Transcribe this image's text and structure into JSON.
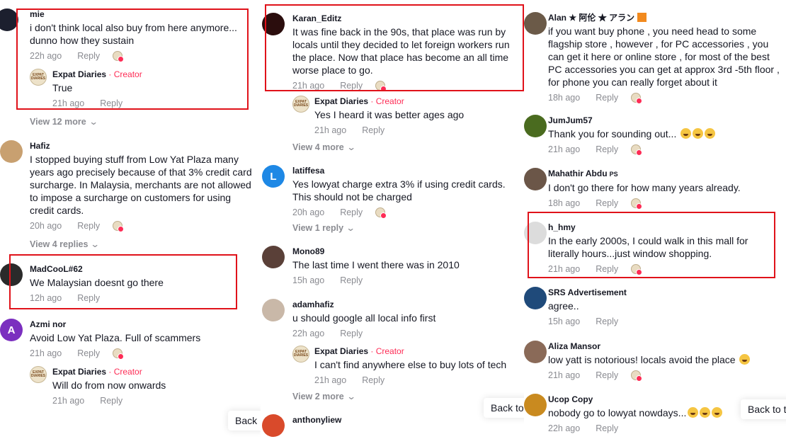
{
  "col1": {
    "c1": {
      "user": "mie",
      "text": "i don't think local also buy from here anymore... dunno how they sustain",
      "time": "22h ago",
      "reply": "Reply"
    },
    "c1r": {
      "user": "Expat Diaries",
      "tag": " · Creator",
      "text": "True",
      "time": "21h ago",
      "reply": "Reply"
    },
    "c1more": "View 12 more",
    "c2": {
      "user": "Hafiz",
      "text": "I stopped buying stuff from Low Yat Plaza many years ago precisely because of that 3% credit card surcharge. In Malaysia, merchants are not allowed to impose a surcharge on customers for using credit cards.",
      "time": "20h ago",
      "reply": "Reply"
    },
    "c2more": "View 4 replies",
    "c3": {
      "user": "MadCooL#62",
      "text": "We Malaysian doesnt go there",
      "time": "12h ago",
      "reply": "Reply"
    },
    "c4": {
      "user": "Azmi nor",
      "initial": "A",
      "text": "Avoid Low Yat Plaza. Full of scammers",
      "time": "21h ago",
      "reply": "Reply"
    },
    "c4r": {
      "user": "Expat Diaries",
      "tag": " · Creator",
      "text": "Will do from now onwards",
      "time": "21h ago",
      "reply": "Reply"
    },
    "back": "Back"
  },
  "col2": {
    "c1": {
      "user": "Karan_Editz",
      "text": "It was fine back in the 90s, that place was run by locals until they decided to let foreign workers run the place. Now that place has become an all time worse place to go.",
      "time": "21h ago",
      "reply": "Reply"
    },
    "c1r": {
      "user": "Expat Diaries",
      "tag": " · Creator",
      "text": "Yes I heard it was better ages ago",
      "time": "21h ago",
      "reply": "Reply"
    },
    "c1more": "View 4 more",
    "c2": {
      "user": "latiffesa",
      "initial": "L",
      "text": "Yes lowyat charge extra 3% if using credit cards. This should not be charged",
      "time": "20h ago",
      "reply": "Reply"
    },
    "c2more": "View 1 reply",
    "c3": {
      "user": "Mono89",
      "text": "The last time I went there was in 2010",
      "time": "15h ago",
      "reply": "Reply"
    },
    "c4": {
      "user": "adamhafiz",
      "text": "u should google all local info first",
      "time": "22h ago",
      "reply": "Reply"
    },
    "c4r": {
      "user": "Expat Diaries",
      "tag": " · Creator",
      "text": "I can't find anywhere else to buy lots of tech",
      "time": "21h ago",
      "reply": "Reply"
    },
    "c4more": "View 2 more",
    "c5": {
      "user": "anthonyliew"
    },
    "back": "Back to"
  },
  "col3": {
    "c1": {
      "user": "Alan ★ 阿伦 ★ アラン",
      "text": "if you want buy phone , you need head to some flagship store , however , for PC accessories , you can get it here or online store , for most of the best PC accessories you can get at approx 3rd -5th floor , for phone you can really forget about it",
      "time": "18h ago",
      "reply": "Reply"
    },
    "c2": {
      "user": "JumJum57",
      "text": "Thank you for sounding out...",
      "time": "21h ago",
      "reply": "Reply"
    },
    "c3": {
      "user": "Mahathir Abdu",
      "badge": "PS",
      "text": "I don't go there for how many years already.",
      "time": "18h ago",
      "reply": "Reply"
    },
    "c4": {
      "user": "h_hmy",
      "text": "In the early 2000s, I could walk in this mall for literally hours...just window shopping.",
      "time": "21h ago",
      "reply": "Reply"
    },
    "c5": {
      "user": "SRS Advertisement",
      "text": "agree..",
      "time": "15h ago",
      "reply": "Reply"
    },
    "c6": {
      "user": "Aliza Mansor",
      "text": "low yatt is notorious! locals avoid the place",
      "time": "21h ago",
      "reply": "Reply"
    },
    "c7": {
      "user": "Ucop Copy",
      "text": "nobody go to lowyat nowdays...",
      "time": "22h ago",
      "reply": "Reply"
    },
    "back": "Back to t"
  },
  "creator_logo": "EXPAT DIARIES",
  "colors": {
    "creator": "#fe2c55",
    "muted": "#8a8b91",
    "highlight": "#e0121a",
    "text": "#161823"
  }
}
